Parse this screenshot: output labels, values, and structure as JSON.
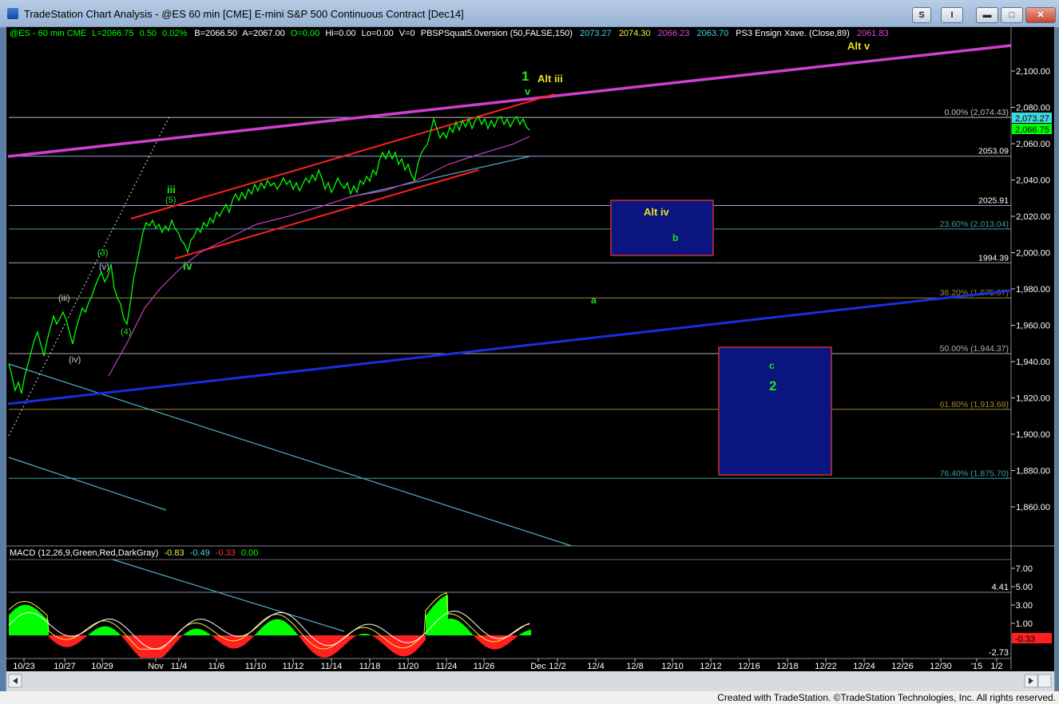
{
  "window": {
    "title": "TradeStation Chart Analysis - @ES 60 min [CME] E-mini S&P 500 Continuous Contract [Dec14]",
    "buttons": [
      "S",
      "I"
    ]
  },
  "status_footer": "Created with TradeStation. ©TradeStation Technologies, Inc. All rights reserved.",
  "colors": {
    "background": "#000000",
    "price": "#00ff00",
    "channel": "#ff2020",
    "magenta_trendline": "#d040d0",
    "blue_trendline": "#1a2ee0",
    "cyan_trendline": "#4fb0c8",
    "target_box": "#0a1580",
    "target_box_border": "#d03030",
    "wave_label": "#20e020",
    "alt_label": "#e8e020"
  },
  "header": {
    "symbol": "@ES - 60 min CME",
    "last": "L=2066.75",
    "change": "0.50",
    "change_pct": "0.02%",
    "bid": "B=2066.50",
    "ask": "A=2067.00",
    "open": "O=0.00",
    "high": "Hi=0.00",
    "low": "Lo=0.00",
    "volume": "V=0",
    "indicator_name": "PBSPSquat5.0version (50,FALSE,150)",
    "indicator_values": [
      "2073.27",
      "2074.30",
      "2066.23",
      "2063.70"
    ],
    "indicator2_name": "PS3 Ensign Xave. (Close,89)",
    "indicator2_value": "2061.83"
  },
  "price_axis": {
    "ticks": [
      "2,100.00",
      "2,080.00",
      "2,060.00",
      "2,040.00",
      "2,020.00",
      "2,000.00",
      "1,980.00",
      "1,960.00",
      "1,940.00",
      "1,920.00",
      "1,900.00",
      "1,880.00",
      "1,860.00"
    ],
    "last_price_tags": [
      "2,073.27",
      "2,066.75"
    ]
  },
  "levels": [
    {
      "label": "0.00% (2,074.43)",
      "kind": "fib"
    },
    {
      "label": "2053.09",
      "kind": "level"
    },
    {
      "label": "2025.91",
      "kind": "level"
    },
    {
      "label": "23.60% (2,013.04)",
      "kind": "fib"
    },
    {
      "label": "1994.39",
      "kind": "level"
    },
    {
      "label": "38.20% (1,975.07)",
      "kind": "fib"
    },
    {
      "label": "50.00% (1,944.37)",
      "kind": "fib"
    },
    {
      "label": "61.80% (1,913.68)",
      "kind": "fib"
    },
    {
      "label": "76.40% (1,875.70)",
      "kind": "fib"
    }
  ],
  "wave_labels": {
    "one": "1",
    "v": "v",
    "alt_iii": "Alt iii",
    "alt_v": "Alt v",
    "alt_iv": "Alt iv",
    "b": "b",
    "a": "a",
    "c": "c",
    "two": "2",
    "iii": "iii",
    "five_paren": "(5)",
    "iv": "iv",
    "three_paren": "(3)",
    "v_paren": "(v)",
    "iii_paren": "(iii)",
    "iv_paren": "(iv)",
    "four_paren": "(4)"
  },
  "macd": {
    "title": "MACD (12,26,9,Green,Red,DarkGray)",
    "values": [
      "-0.83",
      "-0.49",
      "-0.33",
      "0.00"
    ],
    "axis_ticks": [
      "7.00",
      "5.00",
      "3.00",
      "1.00"
    ],
    "level_upper": "4.41",
    "level_lower": "-2.73",
    "current_tag": "-0.33"
  },
  "date_axis": [
    "10/23",
    "10/27",
    "10/29",
    "Nov",
    "11/4",
    "11/6",
    "11/10",
    "11/12",
    "11/14",
    "11/18",
    "11/20",
    "11/24",
    "11/26",
    "Dec",
    "12/2",
    "12/4",
    "12/8",
    "12/10",
    "12/12",
    "12/16",
    "12/18",
    "12/22",
    "12/24",
    "12/26",
    "12/30",
    "'15",
    "1/2"
  ]
}
